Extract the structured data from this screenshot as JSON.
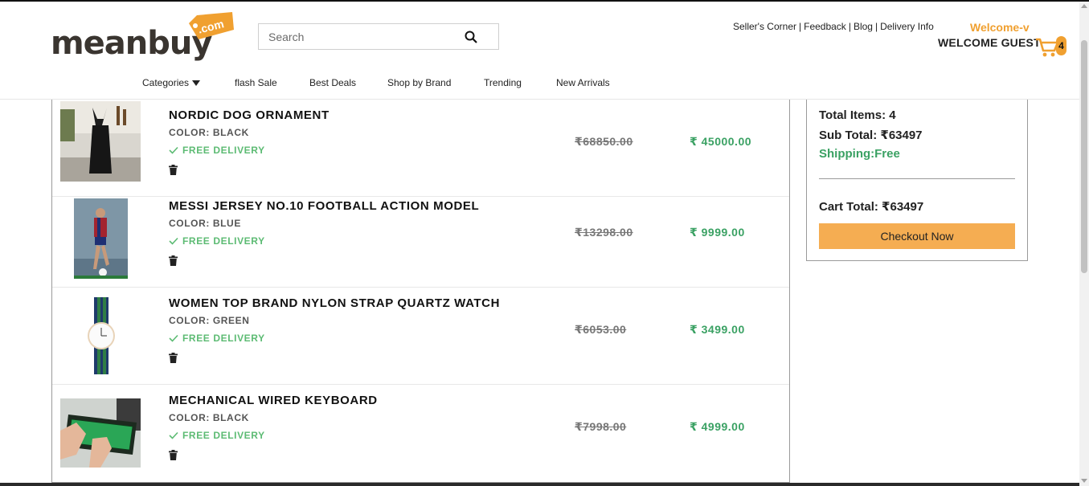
{
  "brand": {
    "logo_text": "meanbuy",
    "logo_tag": ".com",
    "colors": {
      "accent": "#f0a030",
      "price_green": "#3aa163",
      "delivery_green": "#5cbb73",
      "checkout": "#f5ad52"
    }
  },
  "search": {
    "placeholder": "Search",
    "icon": "search-icon"
  },
  "top_links": [
    "Seller's Corner",
    "Feedback",
    "Blog",
    "Delivery Info"
  ],
  "top_links_separator": "|",
  "user": {
    "welcome": "Welcome-v",
    "guest": "WELCOME GUEST"
  },
  "cart_count": "4",
  "nav": [
    "Categories",
    "flash Sale",
    "Best Deals",
    "Shop by Brand",
    "Trending",
    "New Arrivals"
  ],
  "items": [
    {
      "name": "NORDIC DOG ORNAMENT",
      "color": "COLOR: BLACK",
      "delivery": "FREE DELIVERY",
      "mrp": "₹68850.00",
      "price": "₹ 45000.00",
      "image": "black dog ornament photo"
    },
    {
      "name": "MESSI JERSEY NO.10 FOOTBALL ACTION MODEL",
      "color": "COLOR: BLUE",
      "delivery": "FREE DELIVERY",
      "mrp": "₹13298.00",
      "price": "₹ 9999.00",
      "image": "football action model photo"
    },
    {
      "name": "WOMEN TOP BRAND NYLON STRAP QUARTZ WATCH",
      "color": "COLOR: GREEN",
      "delivery": "FREE DELIVERY",
      "mrp": "₹6053.00",
      "price": "₹ 3499.00",
      "image": "striped strap watch photo"
    },
    {
      "name": "MECHANICAL WIRED KEYBOARD",
      "color": "COLOR: BLACK",
      "delivery": "FREE DELIVERY",
      "mrp": "₹7998.00",
      "price": "₹ 4999.00",
      "image": "green backlit keyboard photo"
    }
  ],
  "summary": {
    "total_items": "Total Items: 4",
    "sub_total": "Sub Total: ₹63497",
    "shipping": "Shipping:Free",
    "cart_total": "Cart Total: ₹63497",
    "checkout_label": "Checkout Now"
  }
}
